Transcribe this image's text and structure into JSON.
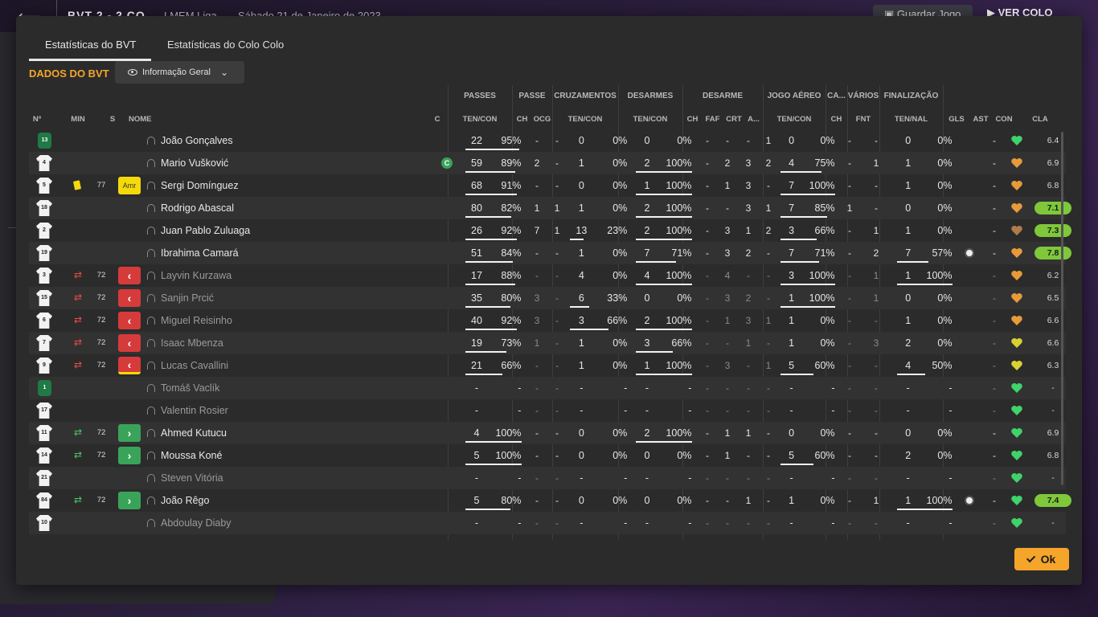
{
  "topbar": {
    "score": "BVT 2 - 2 CO",
    "competition": "LMEM Liga",
    "date": "Sábado 21 de Janeiro de 2023",
    "save_label": "Guardar Jogo",
    "next_label": "VER COLO"
  },
  "modal": {
    "tabs": [
      "Estatísticas do BVT",
      "Estatísticas do Colo Colo"
    ],
    "section_title": "DADOS DO BVT",
    "view_select": "Informação Geral",
    "ok_label": "Ok"
  },
  "headers": {
    "groups": [
      "PASSES",
      "PASSE",
      "CRUZAMENTOS",
      "DESARMES",
      "DESARME",
      "JOGO AÉREO",
      "CA...",
      "VÁRIOS",
      "FINALIZAÇÃO"
    ],
    "cols": [
      "Nº",
      "MIN",
      "S",
      "NOME",
      "C",
      "TEN/CON",
      "CH",
      "OCG",
      "TEN/CON",
      "TEN/CON",
      "CH",
      "FAF",
      "CRT",
      "A...",
      "TEN/CON",
      "CH",
      "FNT",
      "TEN/NAL",
      "GLS",
      "AST",
      "CON",
      "CLA"
    ]
  },
  "players": [
    {
      "num": "13",
      "gk": true,
      "min": "",
      "ev": "",
      "badge": "",
      "name": "João Gonçalves",
      "cap": false,
      "muted": false,
      "pass": [
        "22",
        "95%"
      ],
      "pfrac": 0.95,
      "pch": "-",
      "pocg": "-",
      "cruz": [
        "0",
        "0%"
      ],
      "cfrac": 0,
      "des": [
        "0",
        "0%"
      ],
      "dfrac": 0,
      "dch": "-",
      "faf": "-",
      "crt": "-",
      "a": "1",
      "aer": [
        "0",
        "0%"
      ],
      "afrac": 0,
      "cach": "-",
      "fnt": "-",
      "fin": [
        "0",
        "0%"
      ],
      "ffrac": 0,
      "gls": "",
      "ast": "-",
      "con": "green",
      "cla": "6.4",
      "hi": false
    },
    {
      "num": "4",
      "gk": false,
      "min": "",
      "ev": "",
      "badge": "",
      "name": "Mario Vušković",
      "cap": true,
      "muted": false,
      "pass": [
        "59",
        "89%"
      ],
      "pfrac": 0.89,
      "pch": "2",
      "pocg": "-",
      "cruz": [
        "1",
        "0%"
      ],
      "cfrac": 0,
      "des": [
        "2",
        "100%"
      ],
      "dfrac": 1,
      "dch": "-",
      "faf": "2",
      "crt": "3",
      "a": "2",
      "aer": [
        "4",
        "75%"
      ],
      "afrac": 0.75,
      "cach": "-",
      "fnt": "1",
      "fin": [
        "1",
        "0%"
      ],
      "ffrac": 0,
      "gls": "",
      "ast": "-",
      "con": "orange",
      "cla": "6.9",
      "hi": false
    },
    {
      "num": "5",
      "gk": false,
      "min": "77",
      "ev": "yellow",
      "badge": "Amr",
      "name": "Sergi Domínguez",
      "cap": false,
      "muted": false,
      "pass": [
        "68",
        "91%"
      ],
      "pfrac": 0.91,
      "pch": "-",
      "pocg": "-",
      "cruz": [
        "0",
        "0%"
      ],
      "cfrac": 0,
      "des": [
        "1",
        "100%"
      ],
      "dfrac": 1,
      "dch": "-",
      "faf": "1",
      "crt": "3",
      "a": "-",
      "aer": [
        "7",
        "100%"
      ],
      "afrac": 1,
      "cach": "-",
      "fnt": "-",
      "fin": [
        "1",
        "0%"
      ],
      "ffrac": 0,
      "gls": "",
      "ast": "-",
      "con": "orange",
      "cla": "6.8",
      "hi": false
    },
    {
      "num": "18",
      "gk": false,
      "min": "",
      "ev": "",
      "badge": "",
      "name": "Rodrigo Abascal",
      "cap": false,
      "muted": false,
      "pass": [
        "80",
        "82%"
      ],
      "pfrac": 0.82,
      "pch": "1",
      "pocg": "1",
      "cruz": [
        "1",
        "0%"
      ],
      "cfrac": 0,
      "des": [
        "2",
        "100%"
      ],
      "dfrac": 1,
      "dch": "-",
      "faf": "-",
      "crt": "3",
      "a": "1",
      "aer": [
        "7",
        "85%"
      ],
      "afrac": 0.85,
      "cach": "1",
      "fnt": "-",
      "fin": [
        "0",
        "0%"
      ],
      "ffrac": 0,
      "gls": "",
      "ast": "-",
      "con": "orange",
      "cla": "7.1",
      "hi": true
    },
    {
      "num": "2",
      "gk": false,
      "min": "",
      "ev": "",
      "badge": "",
      "name": "Juan Pablo Zuluaga",
      "cap": false,
      "muted": false,
      "pass": [
        "26",
        "92%"
      ],
      "pfrac": 0.92,
      "pch": "7",
      "pocg": "1",
      "cruz": [
        "13",
        "23%"
      ],
      "cfrac": 0.23,
      "des": [
        "2",
        "100%"
      ],
      "dfrac": 1,
      "dch": "-",
      "faf": "3",
      "crt": "1",
      "a": "2",
      "aer": [
        "3",
        "66%"
      ],
      "afrac": 0.66,
      "cach": "-",
      "fnt": "1",
      "fin": [
        "1",
        "0%"
      ],
      "ffrac": 0,
      "gls": "",
      "ast": "-",
      "con": "brown",
      "cla": "7.3",
      "hi": true
    },
    {
      "num": "19",
      "gk": false,
      "min": "",
      "ev": "",
      "badge": "",
      "name": "Ibrahima Camará",
      "cap": false,
      "muted": false,
      "pass": [
        "51",
        "84%"
      ],
      "pfrac": 0.84,
      "pch": "-",
      "pocg": "-",
      "cruz": [
        "1",
        "0%"
      ],
      "cfrac": 0,
      "des": [
        "7",
        "71%"
      ],
      "dfrac": 0.71,
      "dch": "-",
      "faf": "3",
      "crt": "2",
      "a": "-",
      "aer": [
        "7",
        "71%"
      ],
      "afrac": 0.71,
      "cach": "-",
      "fnt": "2",
      "fin": [
        "7",
        "57%"
      ],
      "ffrac": 0.57,
      "gls": "ball",
      "ast": "-",
      "con": "orange",
      "cla": "7.8",
      "hi": true
    },
    {
      "num": "3",
      "gk": false,
      "min": "72",
      "ev": "out",
      "badge": "off",
      "name": "Layvin Kurzawa",
      "cap": false,
      "muted": true,
      "pass": [
        "17",
        "88%"
      ],
      "pfrac": 0.88,
      "pch": "-",
      "pocg": "-",
      "cruz": [
        "4",
        "0%"
      ],
      "cfrac": 0,
      "des": [
        "4",
        "100%"
      ],
      "dfrac": 1,
      "dch": "-",
      "faf": "4",
      "crt": "-",
      "a": "-",
      "aer": [
        "3",
        "100%"
      ],
      "afrac": 1,
      "cach": "-",
      "fnt": "1",
      "fin": [
        "1",
        "100%"
      ],
      "ffrac": 1,
      "gls": "",
      "ast": "-",
      "con": "orange",
      "cla": "6.2",
      "hi": false
    },
    {
      "num": "15",
      "gk": false,
      "min": "72",
      "ev": "out",
      "badge": "off",
      "name": "Sanjin Prcić",
      "cap": false,
      "muted": true,
      "pass": [
        "35",
        "80%"
      ],
      "pfrac": 0.8,
      "pch": "3",
      "pocg": "-",
      "cruz": [
        "6",
        "33%"
      ],
      "cfrac": 0.33,
      "des": [
        "0",
        "0%"
      ],
      "dfrac": 0,
      "dch": "-",
      "faf": "3",
      "crt": "2",
      "a": "-",
      "aer": [
        "1",
        "100%"
      ],
      "afrac": 1,
      "cach": "-",
      "fnt": "1",
      "fin": [
        "0",
        "0%"
      ],
      "ffrac": 0,
      "gls": "",
      "ast": "-",
      "con": "orange",
      "cla": "6.5",
      "hi": false
    },
    {
      "num": "6",
      "gk": false,
      "min": "72",
      "ev": "out",
      "badge": "off",
      "name": "Miguel Reisinho",
      "cap": false,
      "muted": true,
      "pass": [
        "40",
        "92%"
      ],
      "pfrac": 0.92,
      "pch": "3",
      "pocg": "-",
      "cruz": [
        "3",
        "66%"
      ],
      "cfrac": 0.66,
      "des": [
        "2",
        "100%"
      ],
      "dfrac": 1,
      "dch": "-",
      "faf": "1",
      "crt": "3",
      "a": "1",
      "aer": [
        "1",
        "0%"
      ],
      "afrac": 0,
      "cach": "-",
      "fnt": "-",
      "fin": [
        "1",
        "0%"
      ],
      "ffrac": 0,
      "gls": "",
      "ast": "-",
      "con": "orange",
      "cla": "6.6",
      "hi": false
    },
    {
      "num": "7",
      "gk": false,
      "min": "72",
      "ev": "out",
      "badge": "off",
      "name": "Isaac Mbenza",
      "cap": false,
      "muted": true,
      "pass": [
        "19",
        "73%"
      ],
      "pfrac": 0.73,
      "pch": "1",
      "pocg": "-",
      "cruz": [
        "1",
        "0%"
      ],
      "cfrac": 0,
      "des": [
        "3",
        "66%"
      ],
      "dfrac": 0.66,
      "dch": "-",
      "faf": "-",
      "crt": "1",
      "a": "-",
      "aer": [
        "1",
        "0%"
      ],
      "afrac": 0,
      "cach": "-",
      "fnt": "3",
      "fin": [
        "2",
        "0%"
      ],
      "ffrac": 0,
      "gls": "",
      "ast": "-",
      "con": "yellow",
      "cla": "6.6",
      "hi": false
    },
    {
      "num": "9",
      "gk": false,
      "min": "72",
      "ev": "out",
      "badge": "offy",
      "name": "Lucas Cavallini",
      "cap": false,
      "muted": true,
      "pass": [
        "21",
        "66%"
      ],
      "pfrac": 0.66,
      "pch": "-",
      "pocg": "-",
      "cruz": [
        "1",
        "0%"
      ],
      "cfrac": 0,
      "des": [
        "1",
        "100%"
      ],
      "dfrac": 1,
      "dch": "-",
      "faf": "3",
      "crt": "-",
      "a": "1",
      "aer": [
        "5",
        "60%"
      ],
      "afrac": 0.6,
      "cach": "-",
      "fnt": "-",
      "fin": [
        "4",
        "50%"
      ],
      "ffrac": 0.5,
      "gls": "",
      "ast": "-",
      "con": "yellow",
      "cla": "6.3",
      "hi": false
    },
    {
      "num": "1",
      "gk": true,
      "min": "",
      "ev": "",
      "badge": "",
      "name": "Tomáš Vaclík",
      "cap": false,
      "muted": true,
      "pass": [
        "-",
        "-"
      ],
      "pfrac": 0,
      "pch": "-",
      "pocg": "-",
      "cruz": [
        "-",
        "-"
      ],
      "cfrac": 0,
      "des": [
        "-",
        "-"
      ],
      "dfrac": 0,
      "dch": "-",
      "faf": "-",
      "crt": "-",
      "a": "-",
      "aer": [
        "-",
        "-"
      ],
      "afrac": 0,
      "cach": "-",
      "fnt": "-",
      "fin": [
        "-",
        "-"
      ],
      "ffrac": 0,
      "gls": "",
      "ast": "-",
      "con": "green",
      "cla": "-",
      "hi": false
    },
    {
      "num": "17",
      "gk": false,
      "min": "",
      "ev": "",
      "badge": "",
      "name": "Valentin Rosier",
      "cap": false,
      "muted": true,
      "pass": [
        "-",
        "-"
      ],
      "pfrac": 0,
      "pch": "-",
      "pocg": "-",
      "cruz": [
        "-",
        "-"
      ],
      "cfrac": 0,
      "des": [
        "-",
        "-"
      ],
      "dfrac": 0,
      "dch": "-",
      "faf": "-",
      "crt": "-",
      "a": "-",
      "aer": [
        "-",
        "-"
      ],
      "afrac": 0,
      "cach": "-",
      "fnt": "-",
      "fin": [
        "-",
        "-"
      ],
      "ffrac": 0,
      "gls": "",
      "ast": "-",
      "con": "green",
      "cla": "-",
      "hi": false
    },
    {
      "num": "11",
      "gk": false,
      "min": "72",
      "ev": "in",
      "badge": "on",
      "name": "Ahmed Kutucu",
      "cap": false,
      "muted": false,
      "pass": [
        "4",
        "100%"
      ],
      "pfrac": 1,
      "pch": "-",
      "pocg": "-",
      "cruz": [
        "0",
        "0%"
      ],
      "cfrac": 0,
      "des": [
        "2",
        "100%"
      ],
      "dfrac": 1,
      "dch": "-",
      "faf": "1",
      "crt": "1",
      "a": "-",
      "aer": [
        "0",
        "0%"
      ],
      "afrac": 0,
      "cach": "-",
      "fnt": "-",
      "fin": [
        "0",
        "0%"
      ],
      "ffrac": 0,
      "gls": "",
      "ast": "-",
      "con": "green",
      "cla": "6.9",
      "hi": false
    },
    {
      "num": "14",
      "gk": false,
      "min": "72",
      "ev": "in",
      "badge": "on",
      "name": "Moussa Koné",
      "cap": false,
      "muted": false,
      "pass": [
        "5",
        "100%"
      ],
      "pfrac": 1,
      "pch": "-",
      "pocg": "-",
      "cruz": [
        "0",
        "0%"
      ],
      "cfrac": 0,
      "des": [
        "0",
        "0%"
      ],
      "dfrac": 0,
      "dch": "-",
      "faf": "1",
      "crt": "-",
      "a": "-",
      "aer": [
        "5",
        "60%"
      ],
      "afrac": 0.6,
      "cach": "-",
      "fnt": "-",
      "fin": [
        "2",
        "0%"
      ],
      "ffrac": 0,
      "gls": "",
      "ast": "-",
      "con": "green",
      "cla": "6.8",
      "hi": false
    },
    {
      "num": "21",
      "gk": false,
      "min": "",
      "ev": "",
      "badge": "",
      "name": "Steven Vitória",
      "cap": false,
      "muted": true,
      "pass": [
        "-",
        "-"
      ],
      "pfrac": 0,
      "pch": "-",
      "pocg": "-",
      "cruz": [
        "-",
        "-"
      ],
      "cfrac": 0,
      "des": [
        "-",
        "-"
      ],
      "dfrac": 0,
      "dch": "-",
      "faf": "-",
      "crt": "-",
      "a": "-",
      "aer": [
        "-",
        "-"
      ],
      "afrac": 0,
      "cach": "-",
      "fnt": "-",
      "fin": [
        "-",
        "-"
      ],
      "ffrac": 0,
      "gls": "",
      "ast": "-",
      "con": "green",
      "cla": "-",
      "hi": false
    },
    {
      "num": "84",
      "gk": false,
      "min": "72",
      "ev": "in",
      "badge": "on",
      "name": "João Rêgo",
      "cap": false,
      "muted": false,
      "pass": [
        "5",
        "80%"
      ],
      "pfrac": 0.8,
      "pch": "-",
      "pocg": "-",
      "cruz": [
        "0",
        "0%"
      ],
      "cfrac": 0,
      "des": [
        "0",
        "0%"
      ],
      "dfrac": 0,
      "dch": "-",
      "faf": "-",
      "crt": "1",
      "a": "-",
      "aer": [
        "1",
        "0%"
      ],
      "afrac": 0,
      "cach": "-",
      "fnt": "1",
      "fin": [
        "1",
        "100%"
      ],
      "ffrac": 1,
      "gls": "ball",
      "ast": "-",
      "con": "green",
      "cla": "7.4",
      "hi": true
    },
    {
      "num": "10",
      "gk": false,
      "min": "",
      "ev": "",
      "badge": "",
      "name": "Abdoulay Diaby",
      "cap": false,
      "muted": true,
      "pass": [
        "-",
        "-"
      ],
      "pfrac": 0,
      "pch": "-",
      "pocg": "-",
      "cruz": [
        "-",
        "-"
      ],
      "cfrac": 0,
      "des": [
        "-",
        "-"
      ],
      "dfrac": 0,
      "dch": "-",
      "faf": "-",
      "crt": "-",
      "a": "-",
      "aer": [
        "-",
        "-"
      ],
      "afrac": 0,
      "cach": "-",
      "fnt": "-",
      "fin": [
        "-",
        "-"
      ],
      "ffrac": 0,
      "gls": "",
      "ast": "-",
      "con": "green",
      "cla": "-",
      "hi": false
    }
  ],
  "colors": {
    "accent": "#f4a52a",
    "rating_high": "#7ec83a",
    "sub_off": "#d63b3b",
    "sub_on": "#3aa35a",
    "yellow_card": "#f5d90a"
  },
  "icons": {
    "back": "arrow-left-icon",
    "save": "floppy-disk-icon",
    "next": "play-icon",
    "view": "eye-icon",
    "select": "chevron-down-icon",
    "player": "person-icon",
    "captain": "captain-icon",
    "goal": "football-icon",
    "condition": "heart-icon",
    "ok": "check-icon"
  }
}
